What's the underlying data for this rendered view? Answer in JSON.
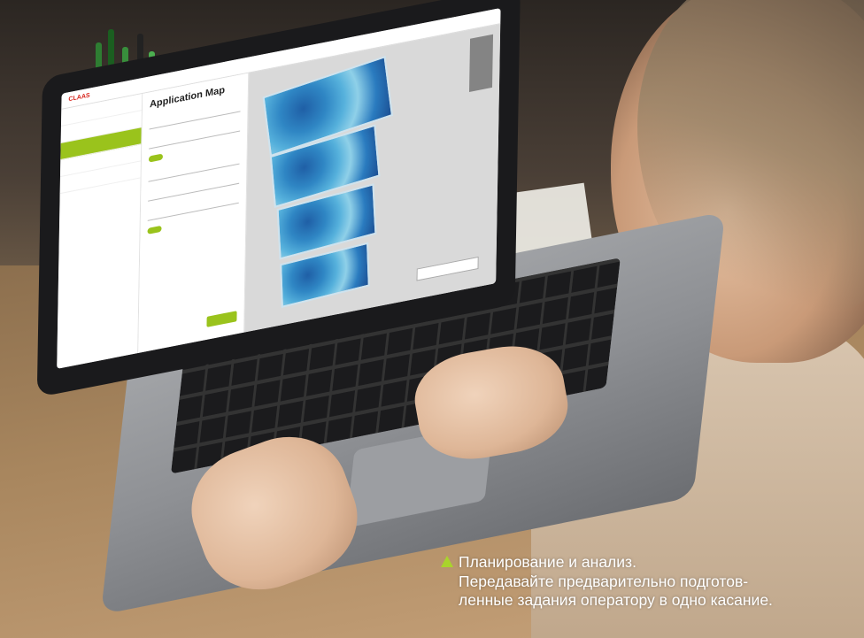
{
  "app_screen": {
    "brand": "CLAAS",
    "panel_title": "Application Map"
  },
  "caption": {
    "lines": [
      "Планирование и анализ.",
      "Передавайте предварительно подготов-",
      "ленные задания оператору в одно касание."
    ],
    "marker_color": "#a9d42c",
    "marker_icon": "triangle-up-icon"
  },
  "colors": {
    "accent_green": "#9ac31c",
    "brand_red": "#d7261e",
    "map_blue": "#2f86c4"
  }
}
